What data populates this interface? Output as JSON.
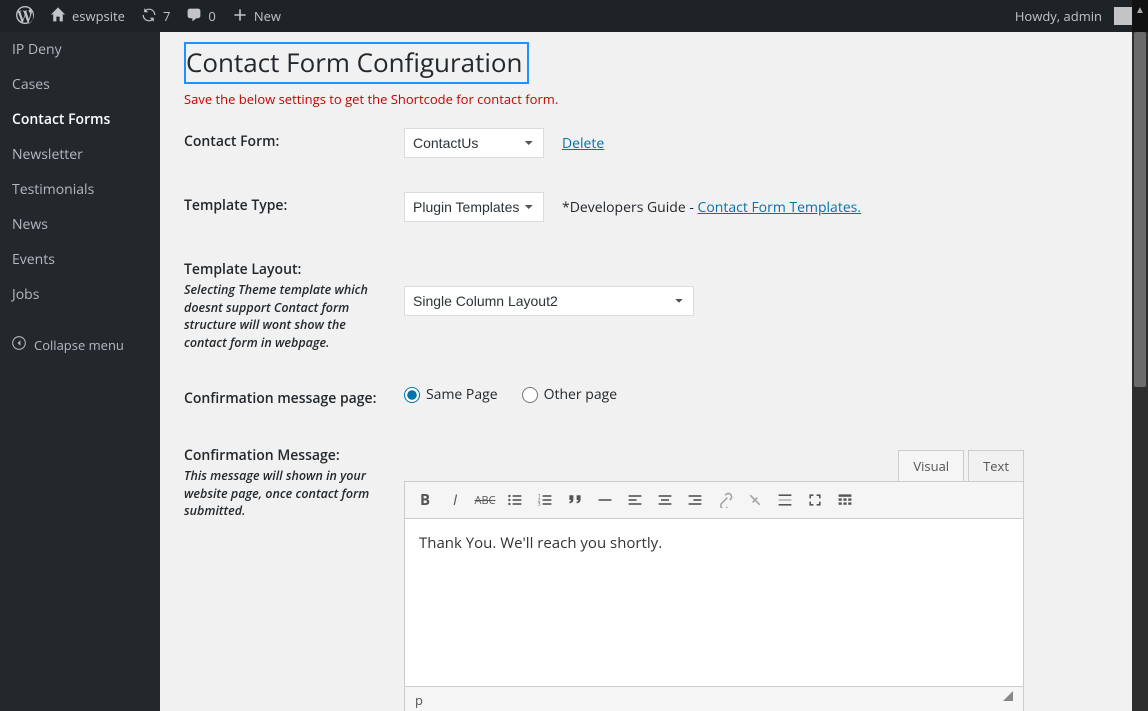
{
  "adminbar": {
    "site_name": "eswpsite",
    "updates_count": "7",
    "comments_count": "0",
    "new_label": "New",
    "howdy": "Howdy, admin"
  },
  "sidebar": {
    "items": [
      {
        "label": "IP Deny",
        "cls": ""
      },
      {
        "label": "Cases",
        "cls": ""
      },
      {
        "label": "Contact Forms",
        "cls": "active"
      },
      {
        "label": "Newsletter",
        "cls": ""
      },
      {
        "label": "Testimonials",
        "cls": ""
      },
      {
        "label": "News",
        "cls": ""
      },
      {
        "label": "Events",
        "cls": ""
      },
      {
        "label": "Jobs",
        "cls": ""
      }
    ],
    "collapse_label": "Collapse menu"
  },
  "page": {
    "title": "Contact Form Configuration",
    "warning": "Save the below settings to get the Shortcode for contact form."
  },
  "fields": {
    "contact_form": {
      "label": "Contact Form:",
      "value": "ContactUs",
      "delete": "Delete"
    },
    "template_type": {
      "label": "Template Type:",
      "value": "Plugin Templates",
      "dev_prefix": "*Developers Guide - ",
      "dev_link": "Contact Form Templates."
    },
    "template_layout": {
      "label": "Template Layout:",
      "hint": "Selecting Theme template which doesnt support Contact form structure will wont show the contact form in webpage.",
      "value": "Single Column Layout2"
    },
    "confirmation_page": {
      "label": "Confirmation message page:",
      "opt1": "Same Page",
      "opt2": "Other page"
    },
    "confirmation_msg": {
      "label": "Confirmation Message:",
      "hint": "This message will shown in your website page, once contact form submitted."
    }
  },
  "editor": {
    "tabs": {
      "visual": "Visual",
      "text": "Text"
    },
    "content": "Thank You. We'll reach you shortly.",
    "status_path": "p"
  }
}
